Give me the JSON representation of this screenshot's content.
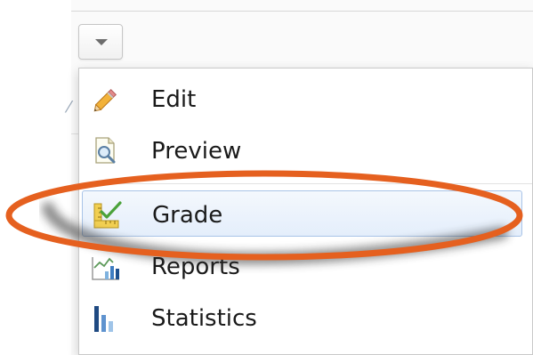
{
  "dropdown": {
    "toggle_icon": "caret-down-icon"
  },
  "menu": {
    "items": [
      {
        "label": "Edit",
        "icon": "pencil-icon"
      },
      {
        "label": "Preview",
        "icon": "preview-magnifier-icon"
      },
      {
        "label": "Grade",
        "icon": "grade-ruler-check-icon",
        "highlighted": true
      },
      {
        "label": "Reports",
        "icon": "reports-chart-icon"
      },
      {
        "label": "Statistics",
        "icon": "statistics-bars-icon"
      }
    ]
  },
  "annotation": {
    "highlight_color": "#e5601f",
    "target": "Grade"
  }
}
